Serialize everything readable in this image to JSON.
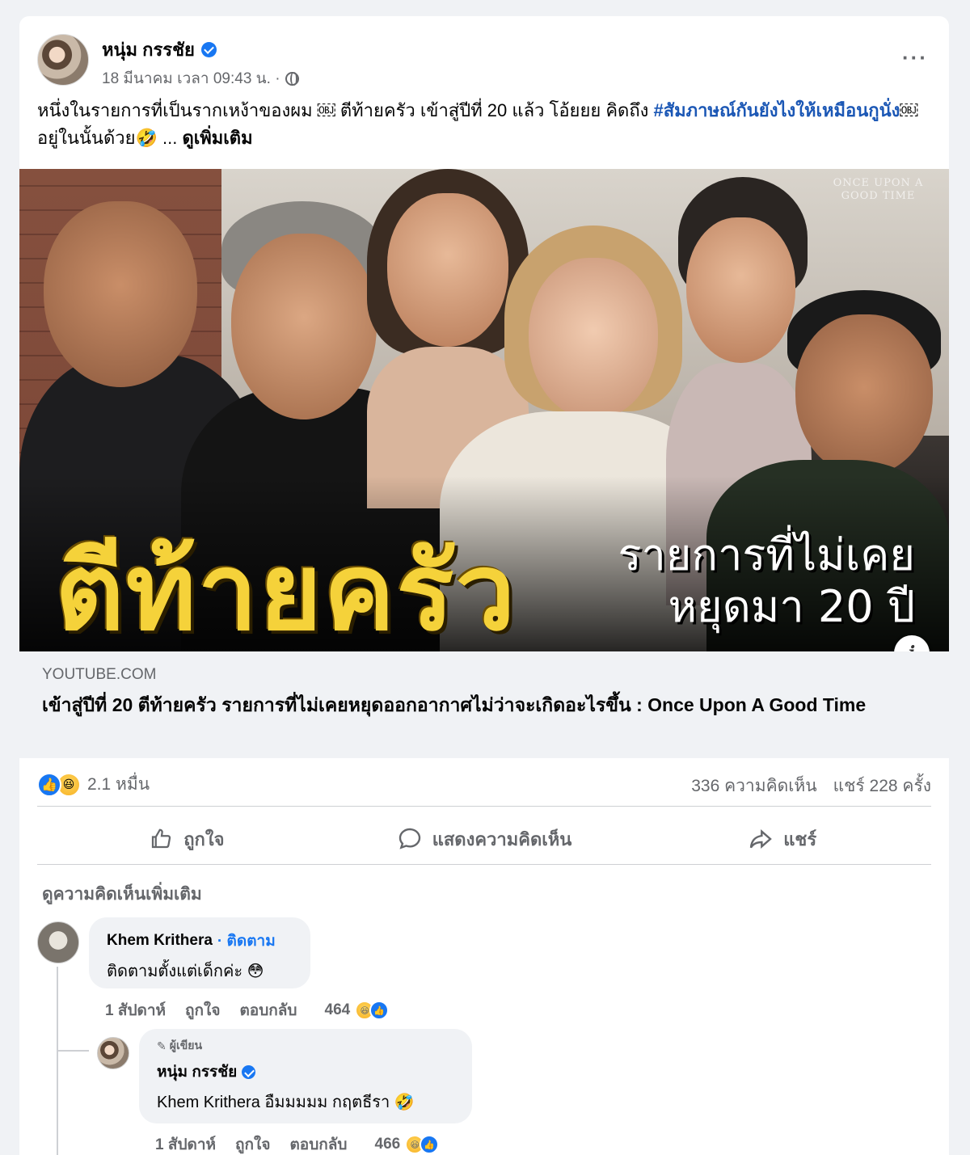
{
  "post": {
    "author": "หนุ่ม กรรชัย",
    "timestamp": "18 มีนาคม เวลา 09:43 น. ·",
    "text_main": "หนึ่งในรายการที่เป็นรากเหง้าของผม ￼ ตีท้ายครัว เข้าสู่ปีที่ 20 แล้ว โอ้ยยย คิดถึง ",
    "hashtag": "#สัมภาษณ์กันยังไงให้เหมือนกูนั่ง",
    "text_tail": "￼อยู่ในนั้นด้วย🤣 ... ",
    "see_more": "ดูเพิ่มเติม",
    "more_options": "···"
  },
  "thumbnail": {
    "big_title": "ตีท้ายครัว",
    "sub_title_line1": "รายการที่ไม่เคย",
    "sub_title_line2": "หยุดมา 20 ปี",
    "show_logo": "ONCE UPON A GOOD TIME",
    "info_label": "i"
  },
  "link": {
    "domain": "YOUTUBE.COM",
    "title": "เข้าสู่ปีที่ 20 ตีท้ายครัว รายการที่ไม่เคยหยุดออกอากาศไม่ว่าจะเกิดอะไรขึ้น : Once Upon A Good Time"
  },
  "stats": {
    "reaction_count": "2.1 หมื่น",
    "comments": "336 ความคิดเห็น",
    "shares": "แชร์ 228 ครั้ง"
  },
  "actions": {
    "like": "ถูกใจ",
    "comment": "แสดงความคิดเห็น",
    "share": "แชร์"
  },
  "more_comments": "ดูความคิดเห็นเพิ่มเติม",
  "comments": [
    {
      "name": "Khem Krithera",
      "follow": "· ติดตาม",
      "text": "ติดตามตั้งแต่เด็กค่ะ 😳",
      "time": "1 สัปดาห์",
      "like": "ถูกใจ",
      "reply": "ตอบกลับ",
      "reactions": "464"
    }
  ],
  "reply": {
    "badge": "ผู้เขียน",
    "name": "หนุ่ม กรรชัย",
    "text": "Khem Krithera อืมมมมม กฤตธีรา 🤣",
    "time": "1 สัปดาห์",
    "like": "ถูกใจ",
    "reply": "ตอบกลับ",
    "reactions": "466"
  },
  "colors": {
    "background": "#f0f2f5",
    "brand_blue": "#1877f2",
    "hashtag": "#1b57b5",
    "secondary_text": "#65676b",
    "title_yellow": "#f5d23a"
  }
}
